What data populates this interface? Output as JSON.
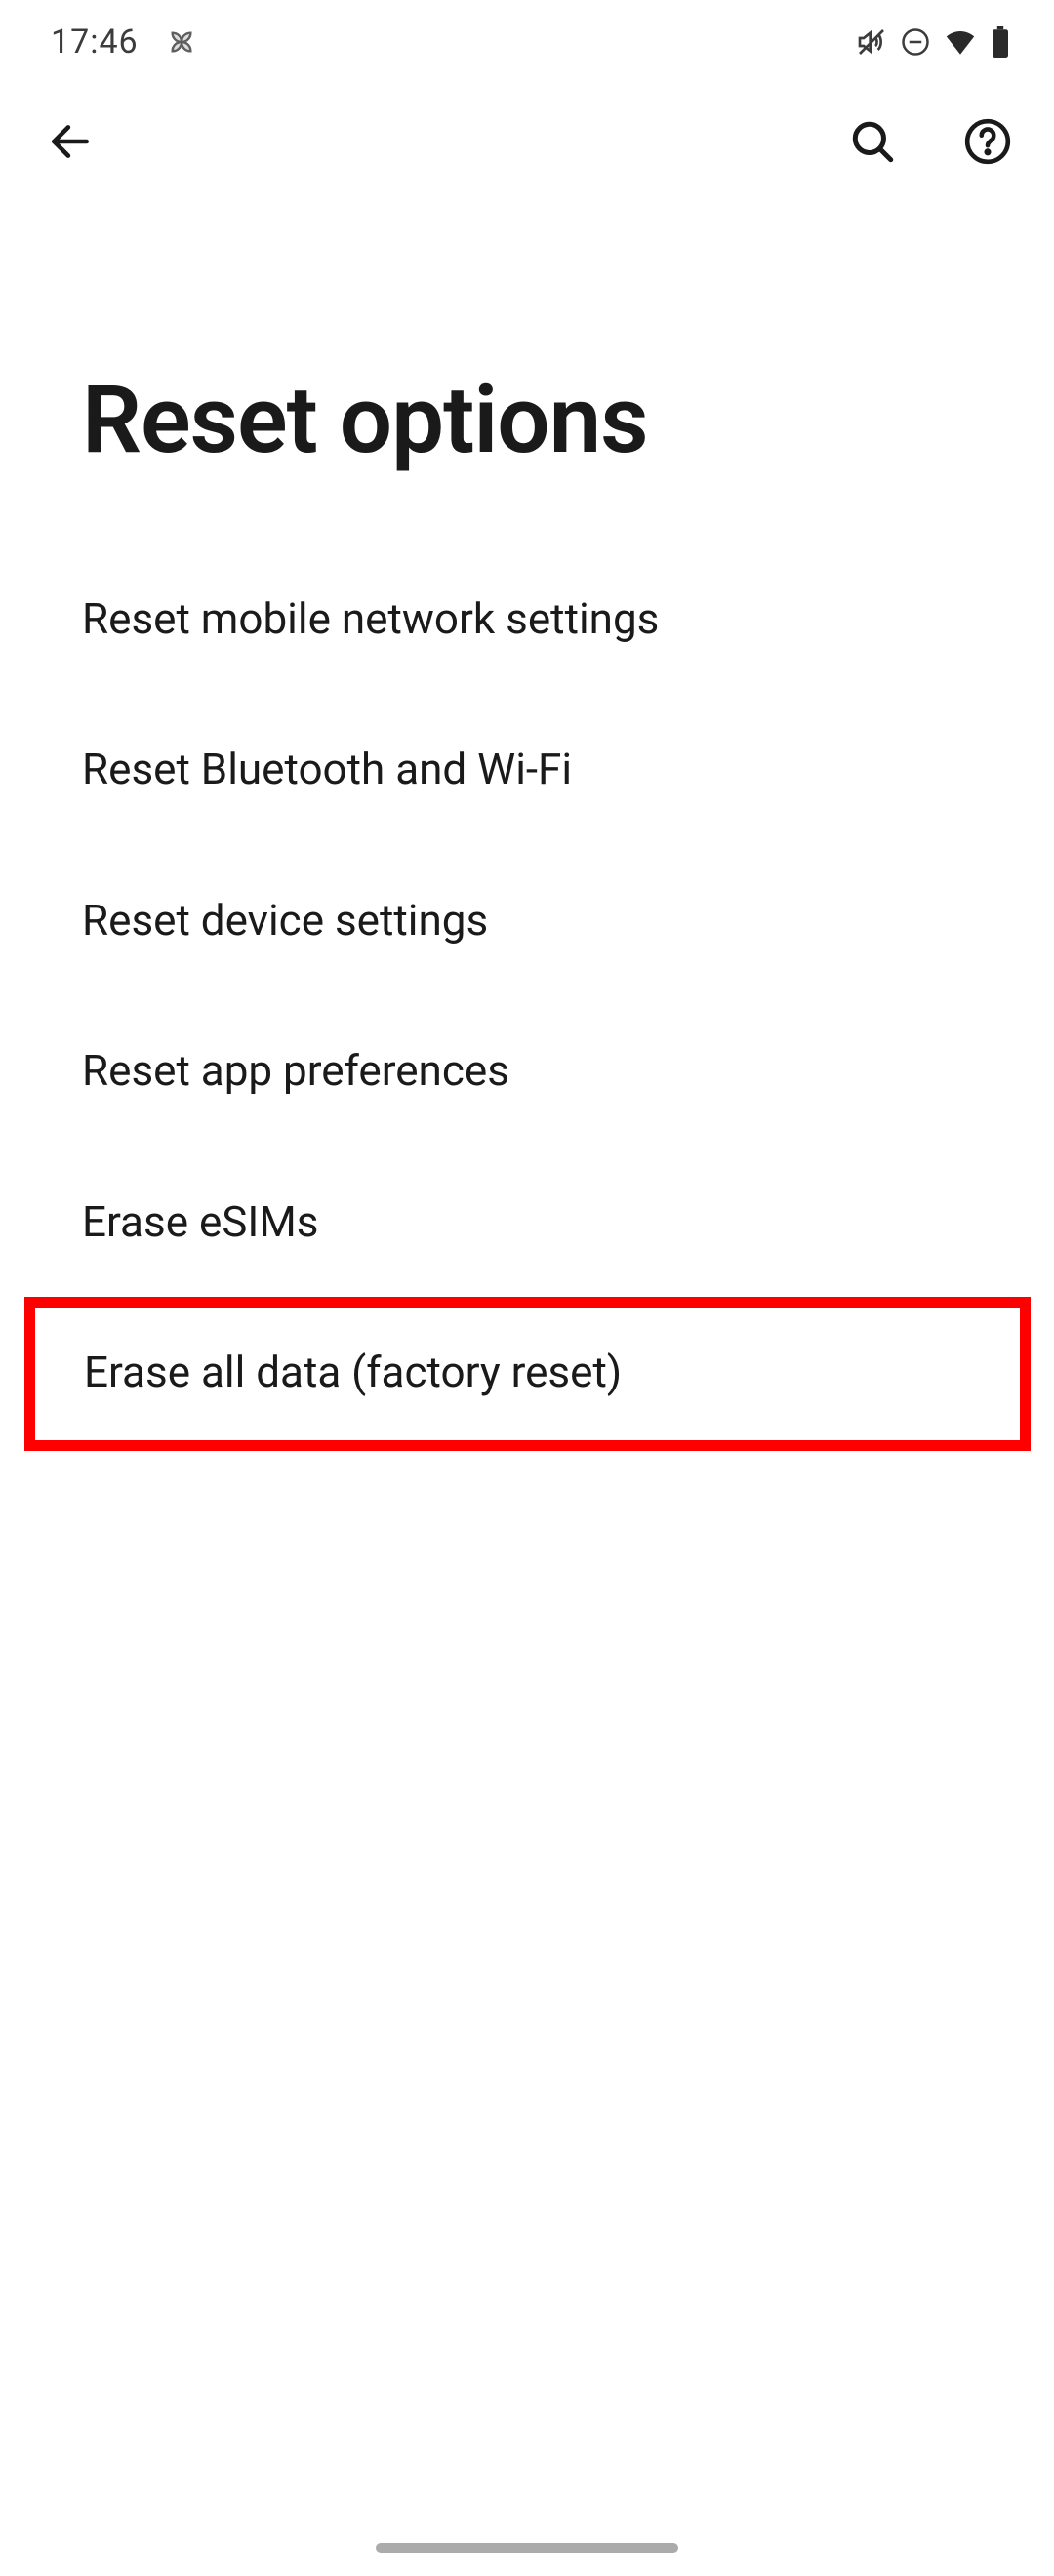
{
  "status": {
    "time": "17:46"
  },
  "page": {
    "title": "Reset options"
  },
  "options": {
    "items": [
      {
        "label": "Reset mobile network settings"
      },
      {
        "label": "Reset Bluetooth and Wi-Fi"
      },
      {
        "label": "Reset device settings"
      },
      {
        "label": "Reset app preferences"
      },
      {
        "label": "Erase eSIMs"
      },
      {
        "label": "Erase all data (factory reset)"
      }
    ],
    "highlighted_index": 5
  }
}
